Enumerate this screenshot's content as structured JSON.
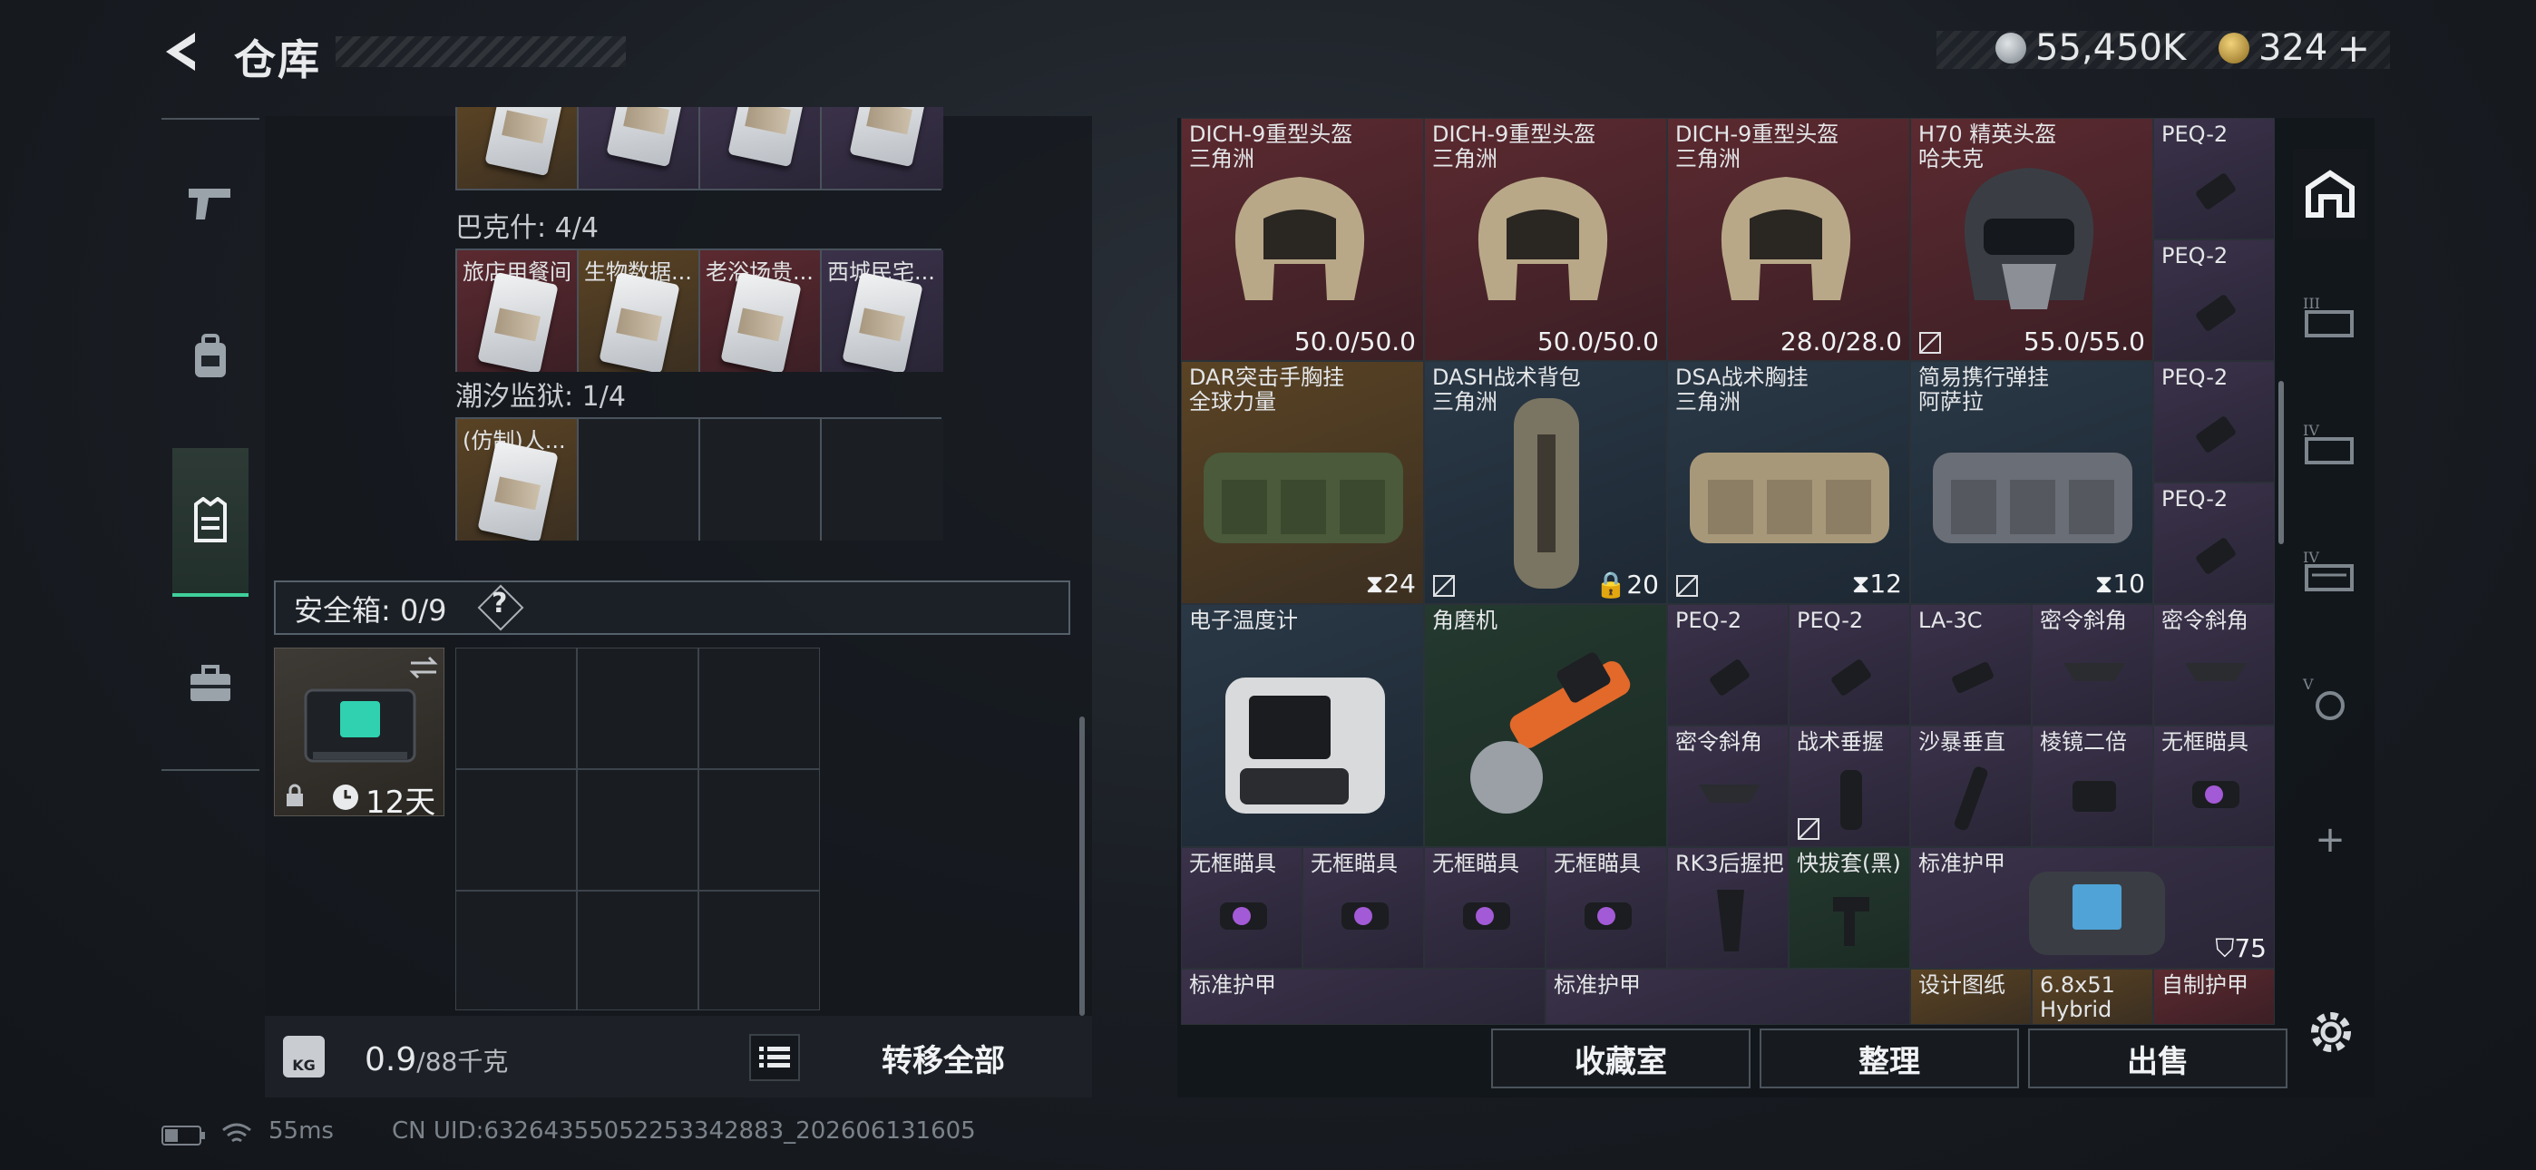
{
  "header": {
    "title": "仓库",
    "currency_silver": "55,450K",
    "currency_gold": "324",
    "add_label": "+"
  },
  "left_nav": [
    "pistol-icon",
    "backpack-icon",
    "vest-icon",
    "briefcase-icon"
  ],
  "storage": {
    "group1_label": "巴克什: 4/4",
    "group1_items": [
      "旅店用餐间",
      "生物数据...",
      "老浴场贵...",
      "西城民宅..."
    ],
    "group2_label": "潮汐监狱: 1/4",
    "group2_items": [
      "(仿制)人..."
    ]
  },
  "safe_box": {
    "label": "安全箱: 0/9",
    "help": "?",
    "timer": "12天"
  },
  "weight": {
    "kg_icon": "KG",
    "current": "0.9",
    "max": "/88千克"
  },
  "transfer_all": "转移全部",
  "inventory": {
    "row1": [
      {
        "name": "DICH-9重型头盔",
        "sub": "三角洲",
        "val": "50.0/50.0"
      },
      {
        "name": "DICH-9重型头盔",
        "sub": "三角洲",
        "val": "50.0/50.0"
      },
      {
        "name": "DICH-9重型头盔",
        "sub": "三角洲",
        "val": "28.0/28.0"
      },
      {
        "name": "H70 精英头盔",
        "sub": "哈夫克",
        "val": "55.0/55.0"
      }
    ],
    "peq": [
      "PEQ-2",
      "PEQ-2",
      "PEQ-2",
      "PEQ-2"
    ],
    "row2": [
      {
        "name": "DAR突击手胸挂",
        "sub": "全球力量",
        "val": "24"
      },
      {
        "name": "DASH战术背包",
        "sub": "三角洲",
        "val": "20"
      },
      {
        "name": "DSA战术胸挂",
        "sub": "三角洲",
        "val": "12"
      },
      {
        "name": "简易携行弹挂",
        "sub": "阿萨拉",
        "val": "10"
      }
    ],
    "row3_big": [
      "电子温度计",
      "角磨机"
    ],
    "row3_small": [
      "PEQ-2",
      "PEQ-2",
      "LA-3C",
      "密令斜角",
      "密令斜角"
    ],
    "row4_small": [
      "密令斜角",
      "战术垂握",
      "沙暴垂直",
      "棱镜二倍",
      "无框瞄具"
    ],
    "row5": [
      "无框瞄具",
      "无框瞄具",
      "无框瞄具",
      "无框瞄具",
      "RK3后握把",
      "快拔套(黑)"
    ],
    "armor": {
      "name": "标准护甲",
      "val": "75"
    },
    "row6": [
      "标准护甲",
      "标准护甲",
      "设计图纸",
      "6.8x51",
      "自制护甲"
    ],
    "row6_sub": "Hybrid"
  },
  "actions": [
    "收藏室",
    "整理",
    "出售"
  ],
  "right_nav": [
    "base-icon",
    "tier3-icon",
    "tier4-icon",
    "tier4b-icon",
    "tier5-icon",
    "add-icon"
  ],
  "right_add": "+",
  "status": {
    "ping": "55ms",
    "uid": "CN UID:63264355052253342883_202606131605"
  }
}
